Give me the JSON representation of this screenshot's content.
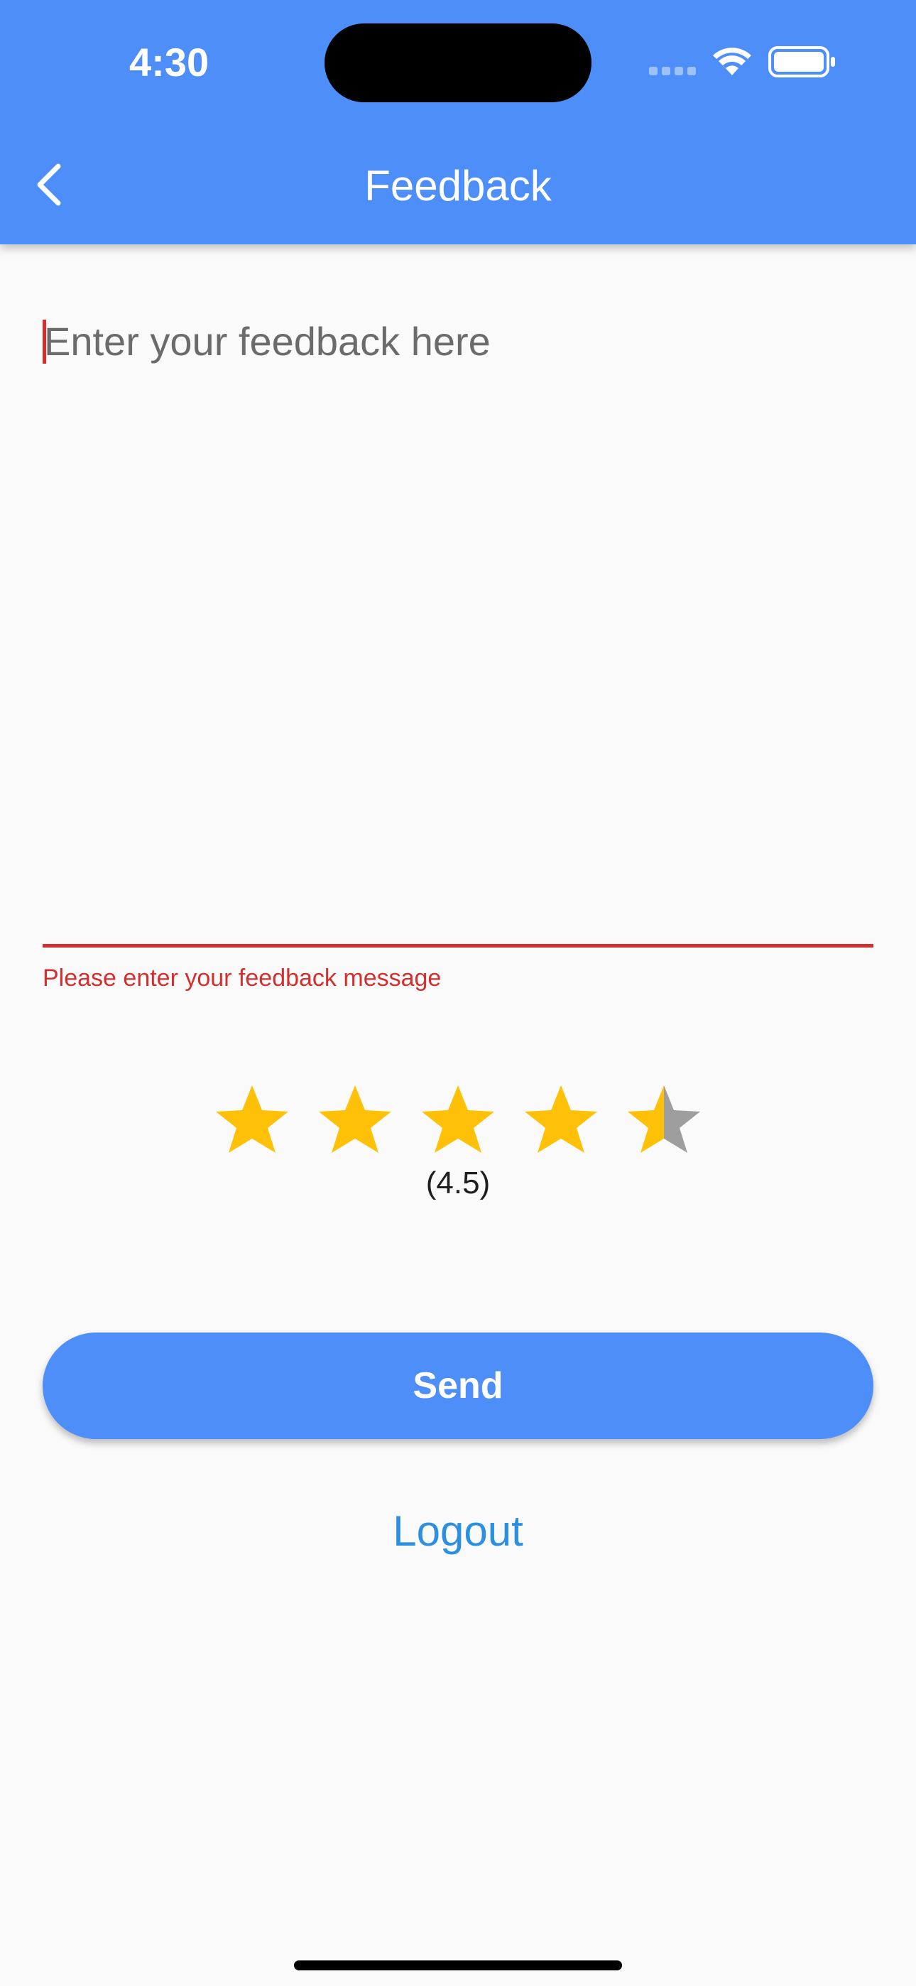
{
  "status_bar": {
    "time": "4:30",
    "icons": [
      "signal-icon",
      "wifi-icon",
      "battery-icon"
    ]
  },
  "app_bar": {
    "title": "Feedback",
    "back_icon": "chevron-left-icon",
    "background_color": "#4D8EF8"
  },
  "feedback_form": {
    "input_value": "",
    "placeholder": "Enter your feedback here",
    "error_message": "Please enter your feedback message",
    "error_color": "#D32F2F"
  },
  "rating": {
    "value": 4.5,
    "max": 5,
    "label": "(4.5)",
    "filled_color": "#FFC107",
    "empty_color": "#9E9E9E"
  },
  "actions": {
    "send_label": "Send",
    "logout_label": "Logout",
    "link_color": "#2D8FE0"
  }
}
